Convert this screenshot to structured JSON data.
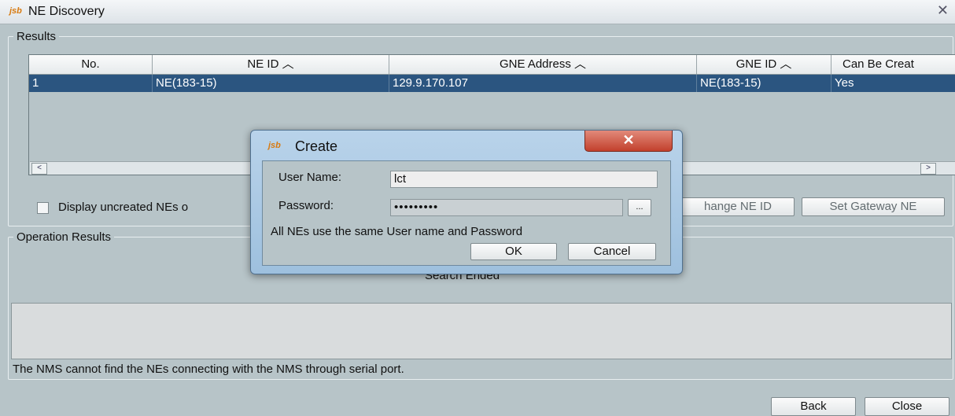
{
  "window": {
    "title": "NE Discovery",
    "close_glyph": "✕",
    "logo_text": "jsb"
  },
  "results": {
    "legend": "Results",
    "columns": [
      "No.",
      "NE ID ︿",
      "GNE Address ︿",
      "GNE ID ︿",
      "Can Be Creat"
    ],
    "rows": [
      [
        "1",
        "NE(183-15)",
        "129.9.170.107",
        "NE(183-15)",
        "Yes"
      ]
    ],
    "scroll_left": "<",
    "scroll_right": ">",
    "display_uncreated_label": "Display uncreated NEs o",
    "change_ne_id_button": "hange NE ID",
    "set_gateway_ne_button": "Set Gateway NE"
  },
  "operation": {
    "legend": "Operation Results",
    "status": "Search Ended",
    "message": "The NMS cannot find the NEs connecting with the NMS through serial port."
  },
  "footer": {
    "back_button": "Back",
    "close_button": "Close"
  },
  "dialog": {
    "title": "Create",
    "close_glyph": "✕",
    "user_name_label": "User Name:",
    "user_name_value": "lct",
    "password_label": "Password:",
    "password_value": "•••••••••",
    "browse_button": "...",
    "note": "All NEs use the same User name and Password",
    "ok_button": "OK",
    "cancel_button": "Cancel"
  },
  "colors": {
    "background": "#b7c4c8",
    "selection": "#2b5580",
    "dialog_frame": "#a9c7e3",
    "close_red": "#c2402c"
  },
  "icons": [
    "app-logo-icon",
    "close-icon",
    "sort-ascending-icon",
    "scroll-left-icon",
    "scroll-right-icon",
    "checkbox-icon"
  ]
}
